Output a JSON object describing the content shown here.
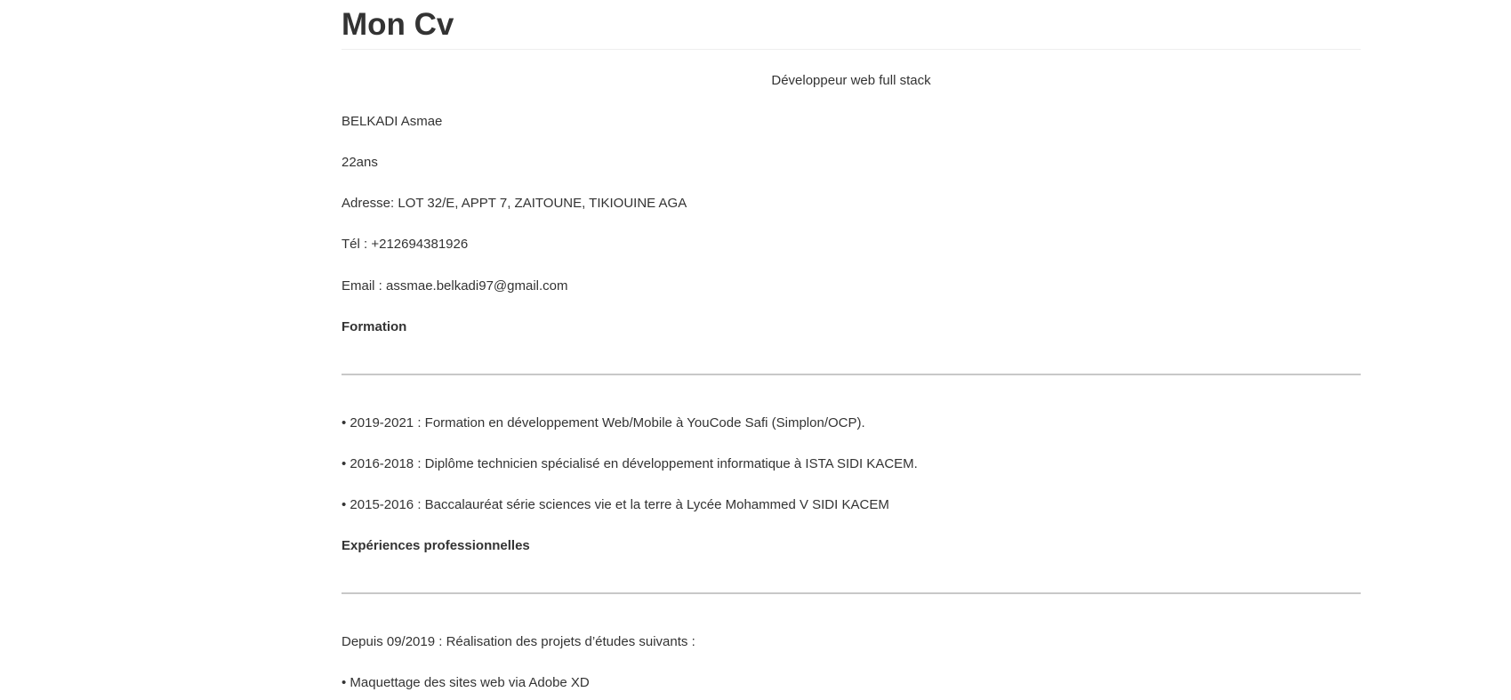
{
  "title": "Mon Cv",
  "subtitle": "Développeur web full stack",
  "personal": {
    "name": "BELKADI Asmae",
    "age": "22ans",
    "address": "Adresse: LOT 32/E, APPT 7, ZAITOUNE, TIKIOUINE AGA",
    "phone": "Tél : +212694381926",
    "email": "Email : assmae.belkadi97@gmail.com"
  },
  "formation": {
    "heading": "Formation",
    "items": [
      "• 2019-2021 : Formation en développement Web/Mobile à YouCode Safi (Simplon/OCP).",
      "• 2016-2018 : Diplôme technicien spécialisé en développement informatique à ISTA SIDI KACEM.",
      "• 2015-2016 : Baccalauréat série sciences vie et la terre à Lycée Mohammed V SIDI KACEM"
    ]
  },
  "experience": {
    "heading": "Expériences professionnelles",
    "intro": "Depuis 09/2019 : Réalisation des projets d’études suivants :",
    "items": [
      "• Maquettage des sites web via Adobe XD"
    ]
  }
}
